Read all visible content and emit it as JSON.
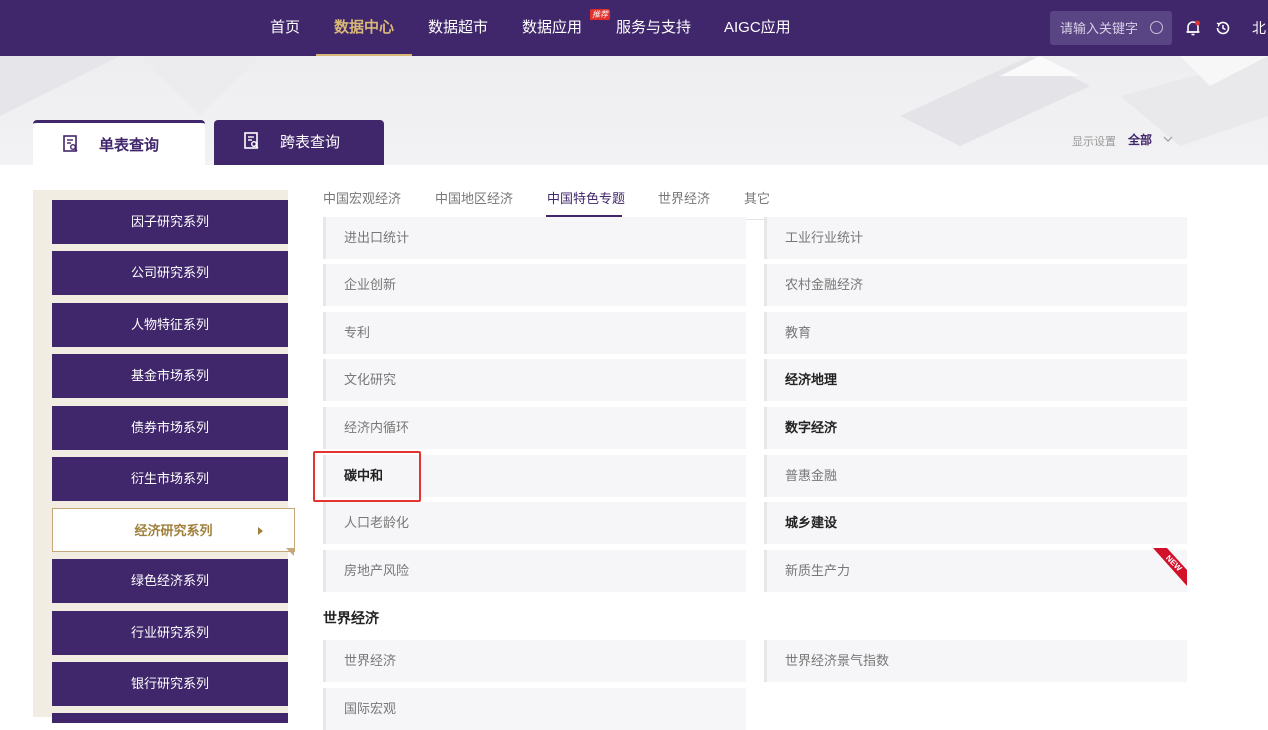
{
  "topnav": {
    "items": [
      "首页",
      "数据中心",
      "数据超市",
      "数据应用",
      "服务与支持",
      "AIGC应用"
    ],
    "badge": "推荐",
    "search_placeholder": "请输入关键字",
    "user": "北"
  },
  "tabs": {
    "single": "单表查询",
    "cross": "跨表查询"
  },
  "display": {
    "label": "显示设置",
    "value": "全部"
  },
  "sidebar": {
    "items": [
      "因子研究系列",
      "公司研究系列",
      "人物特征系列",
      "基金市场系列",
      "债券市场系列",
      "衍生市场系列",
      "经济研究系列",
      "绿色经济系列",
      "行业研究系列",
      "银行研究系列"
    ]
  },
  "subtabs": [
    "中国宏观经济",
    "中国地区经济",
    "中国特色专题",
    "世界经济",
    "其它"
  ],
  "grid": {
    "left": [
      "进出口统计",
      "企业创新",
      "专利",
      "文化研究",
      "经济内循环",
      "碳中和",
      "人口老龄化",
      "房地产风险"
    ],
    "right": [
      "工业行业统计",
      "农村金融经济",
      "教育",
      "经济地理",
      "数字经济",
      "普惠金融",
      "城乡建设",
      "新质生产力"
    ]
  },
  "world": {
    "title": "世界经济",
    "left": [
      "世界经济",
      "国际宏观"
    ],
    "right": [
      "世界经济景气指数"
    ]
  },
  "new_tag": "NEW",
  "colors": {
    "primary": "#40266b",
    "accent": "#d8b877",
    "highlight": "#e3342f"
  }
}
